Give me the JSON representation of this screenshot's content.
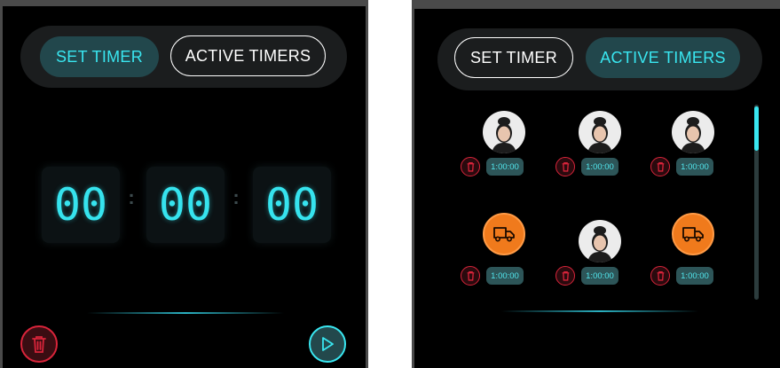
{
  "left": {
    "tabs": {
      "set_timer": "SET TIMER",
      "active_timers": "ACTIVE TIMERS"
    },
    "digits": {
      "hours": "00",
      "minutes": "00",
      "seconds": "00",
      "separator": ":"
    },
    "icons": {
      "delete": "trash-icon",
      "start": "play-icon"
    }
  },
  "right": {
    "tabs": {
      "set_timer": "SET TIMER",
      "active_timers": "ACTIVE TIMERS"
    },
    "timers": [
      {
        "avatar": "person-avatar",
        "time": "1:00:00"
      },
      {
        "avatar": "person-avatar",
        "time": "1:00:00"
      },
      {
        "avatar": "person-avatar",
        "time": "1:00:00"
      },
      {
        "avatar": "truck-icon",
        "time": "1:00:00"
      },
      {
        "avatar": "person-avatar",
        "time": "1:00:00"
      },
      {
        "avatar": "truck-icon",
        "time": "1:00:00"
      }
    ]
  },
  "colors": {
    "accent": "#39e6f0",
    "active_tab_bg": "#22474c",
    "danger": "#d8243a",
    "truck_orange": "#f07a1c",
    "background": "#000000"
  }
}
